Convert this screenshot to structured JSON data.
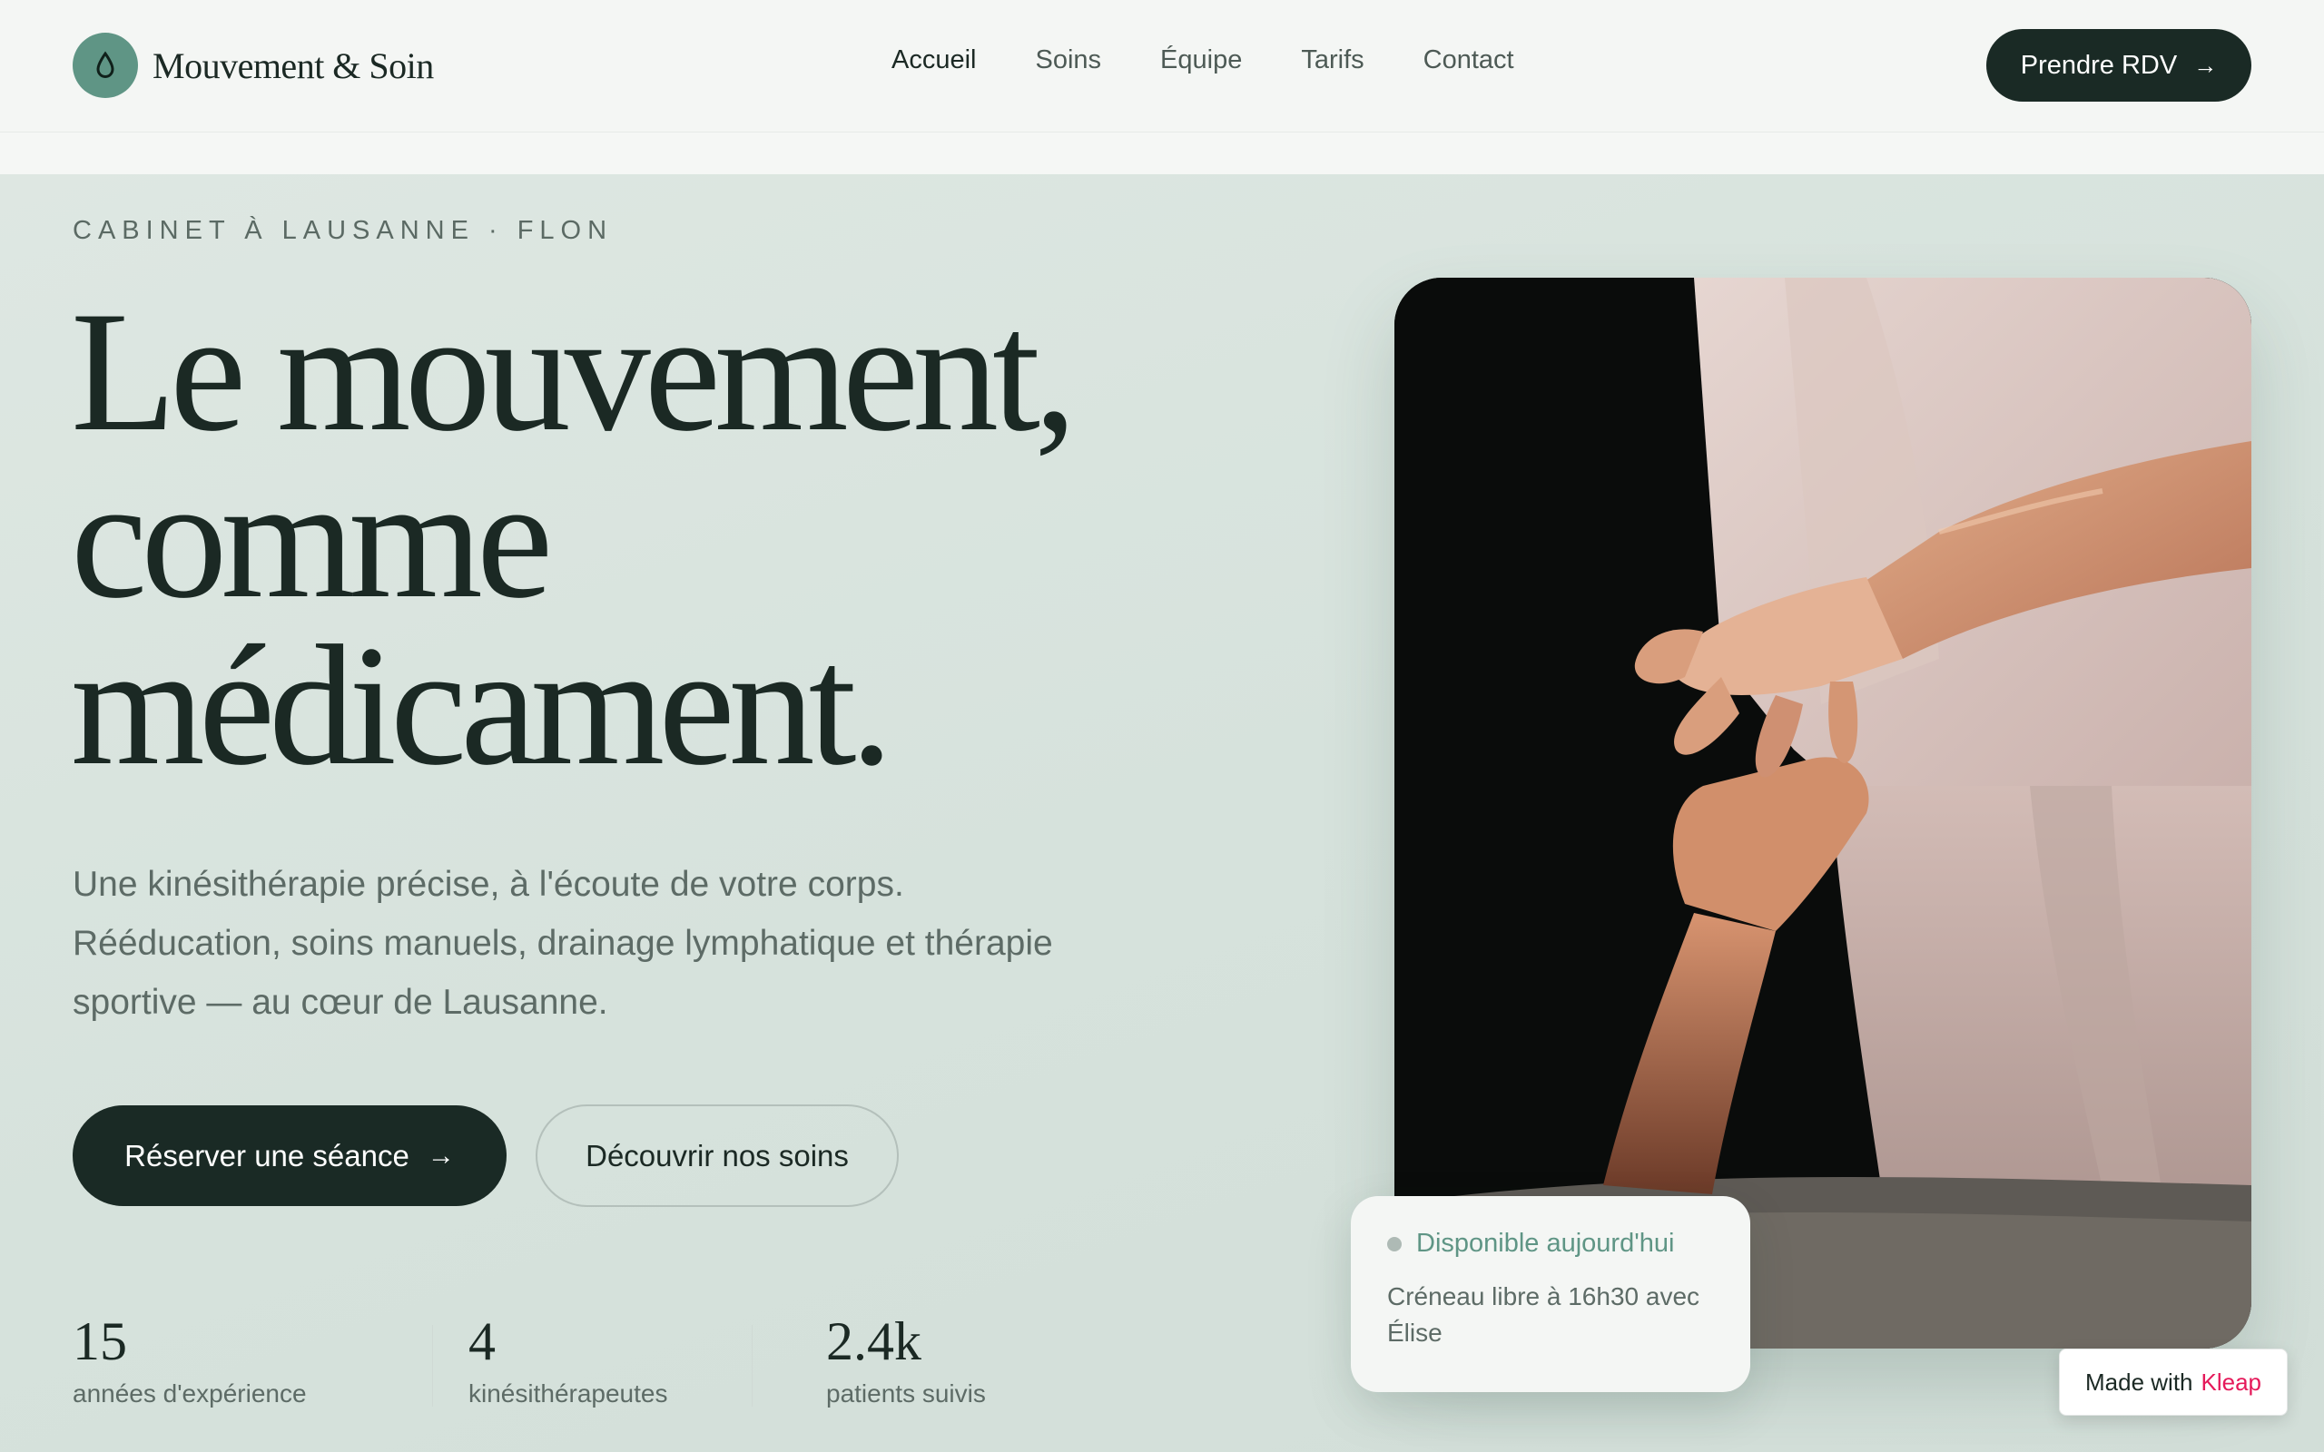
{
  "header": {
    "brand": "Mouvement & Soin",
    "logo_icon": "drop-icon",
    "nav": [
      {
        "label": "Accueil",
        "active": true
      },
      {
        "label": "Soins",
        "active": false
      },
      {
        "label": "Équipe",
        "active": false
      },
      {
        "label": "Tarifs",
        "active": false
      },
      {
        "label": "Contact",
        "active": false
      }
    ],
    "cta_label": "Prendre RDV",
    "cta_icon": "arrow-right-icon"
  },
  "hero": {
    "eyebrow": "CABINET À LAUSANNE · FLON",
    "headline": [
      "Le mouvement,",
      "comme",
      "médicament."
    ],
    "lead": "Une kinésithérapie précise, à l'écoute de votre corps. Rééducation, soins manuels, drainage lymphatique et thérapie sportive — au cœur de Lausanne.",
    "primary_button": "Réserver une séance",
    "secondary_button": "Découvrir nos soins",
    "stats": [
      {
        "value": "15",
        "label": "années d'expérience"
      },
      {
        "value": "4",
        "label": "kinésithérapeutes"
      },
      {
        "value": "2.4k",
        "label": "patients suivis"
      }
    ]
  },
  "availability": {
    "status": "Disponible aujourd'hui",
    "text": "Créneau libre à 16h30 avec Élise"
  },
  "badge": {
    "prefix": "Made with",
    "brand": "Kleap"
  },
  "colors": {
    "accent": "#5f9585",
    "dark": "#1a2a25",
    "background": "#dbe5e0",
    "badge_brand": "#e5195a"
  }
}
